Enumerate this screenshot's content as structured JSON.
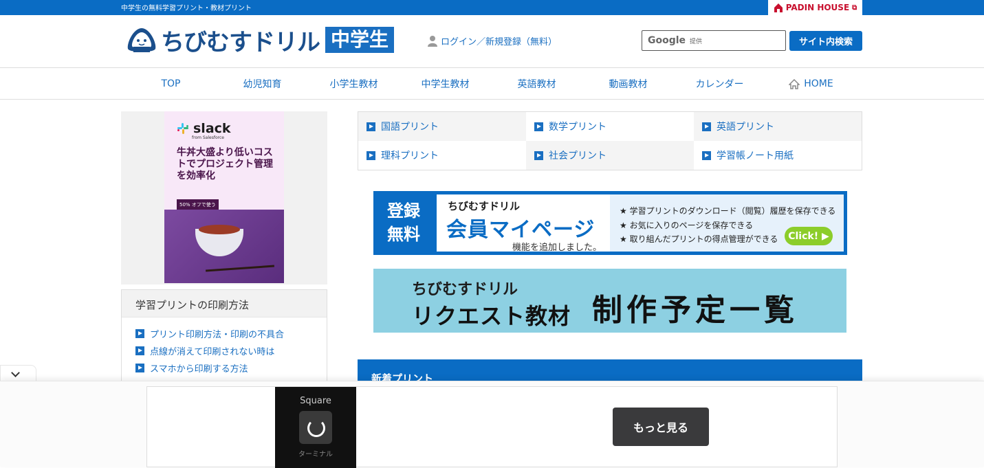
{
  "topbar": {
    "tagline": "中学生の無料学習プリント・教材プリント",
    "partner": "PADIN HOUSE"
  },
  "header": {
    "brand": "ちびむすドリル",
    "grade": "中学生",
    "login": "ログイン／新規登録（無料）",
    "search_brand": "Google",
    "search_provided": "提供",
    "search_button": "サイト内検索"
  },
  "nav": {
    "items": [
      "TOP",
      "幼児知育",
      "小学生教材",
      "中学生教材",
      "英語教材",
      "動画教材",
      "カレンダー",
      "HOME"
    ]
  },
  "side_ad": {
    "brand": "slack",
    "from": "from Salesforce",
    "copy": "牛丼大盛より低いコストでプロジェクト管理を効率化",
    "badge": "50% オフで使う"
  },
  "howto": {
    "title": "学習プリントの印刷方法",
    "links": [
      "プリント印刷方法・印刷の不具合",
      "点線が消えて印刷されない時は",
      "スマホから印刷する方法"
    ]
  },
  "subjects": [
    "国語プリント",
    "数学プリント",
    "英語プリント",
    "理科プリント",
    "社会プリント",
    "学習帳ノート用紙"
  ],
  "member_banner": {
    "badge_line1": "登録",
    "badge_line2": "無料",
    "brand": "ちびむすドリル",
    "title": "会員マイページ",
    "subtitle": "機能を追加しました。",
    "points": [
      "★ 学習プリントのダウンロード（閲覧）履歴を保存できる",
      "★ お気に入りのページを保存できる",
      "★ 取り組んだプリントの得点管理ができる"
    ],
    "click": "Click! ▶"
  },
  "request_banner": {
    "brand": "ちびむすドリル",
    "left": "リクエスト教材",
    "right": "制作予定一覧"
  },
  "new_prints": {
    "title": "新着プリント"
  },
  "anchor_ad": {
    "app_title": "Square",
    "app_caption": "ターミナル",
    "more": "もっと見る"
  },
  "colors": {
    "brand_blue": "#0a6cc4",
    "link_blue": "#1a6fc1",
    "request_bg": "#8dd0e2"
  }
}
